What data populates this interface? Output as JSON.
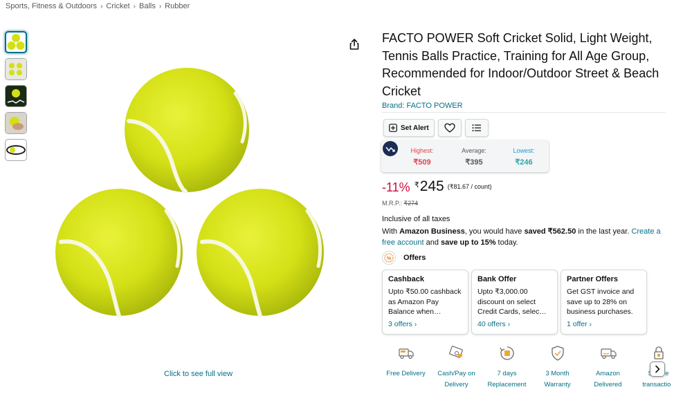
{
  "breadcrumb": [
    "Sports, Fitness & Outdoors",
    "Cricket",
    "Balls",
    "Rubber"
  ],
  "breadcrumb_separator": "›",
  "product": {
    "title": "FACTO POWER Soft Cricket Solid, Light Weight, Tennis Balls Practice, Training for All Age Group, Recommended for Indoor/Outdoor Street & Beach Cricket",
    "brand_label": "Brand: FACTO POWER",
    "see_full_view": "Click to see full view"
  },
  "toolbar": {
    "set_alert": "Set Alert"
  },
  "price_tracker": {
    "highest_label": "Highest:",
    "highest_value": "₹509",
    "average_label": "Average:",
    "average_value": "₹395",
    "lowest_label": "Lowest:",
    "lowest_value": "₹246"
  },
  "pricing": {
    "discount": "-11%",
    "currency": "₹",
    "price": "245",
    "unit_price": "(₹81.67 / count)",
    "mrp_label": "M.R.P.:",
    "mrp_value": "₹274",
    "inclusive": "Inclusive of all taxes"
  },
  "business": {
    "pre": "With ",
    "amazon_business": "Amazon Business",
    "mid": ", you would have ",
    "saved": "saved ₹562.50",
    "post": " in the last year. ",
    "link": "Create a free account",
    "and": " and ",
    "save_up": "save up to 15%",
    "today": " today."
  },
  "offers": {
    "heading": "Offers",
    "cards": [
      {
        "title": "Cashback",
        "desc": "Upto ₹50.00 cashback as Amazon Pay Balance when…",
        "link": "3 offers ›"
      },
      {
        "title": "Bank Offer",
        "desc": "Upto ₹3,000.00 discount on select Credit Cards, selec…",
        "link": "40 offers ›"
      },
      {
        "title": "Partner Offers",
        "desc": "Get GST invoice and save up to 28% on business purchases.",
        "link": "1 offer ›"
      }
    ]
  },
  "features": [
    {
      "icon": "free-delivery-icon",
      "label": "Free Delivery"
    },
    {
      "icon": "cash-pay-icon",
      "label": "Cash/Pay on\nDelivery"
    },
    {
      "icon": "replacement-icon",
      "label": "7 days\nReplacement"
    },
    {
      "icon": "warranty-icon",
      "label": "3 Month\nWarranty"
    },
    {
      "icon": "amazon-delivered-icon",
      "label": "Amazon\nDelivered"
    },
    {
      "icon": "secure-transaction-icon",
      "label": "Secure\ntransaction"
    }
  ],
  "colors": {
    "link": "#007185",
    "discount": "#cc0c39",
    "ball": "#d4e016",
    "highest": "#e0434b",
    "lowest": "#2aa6a8"
  }
}
